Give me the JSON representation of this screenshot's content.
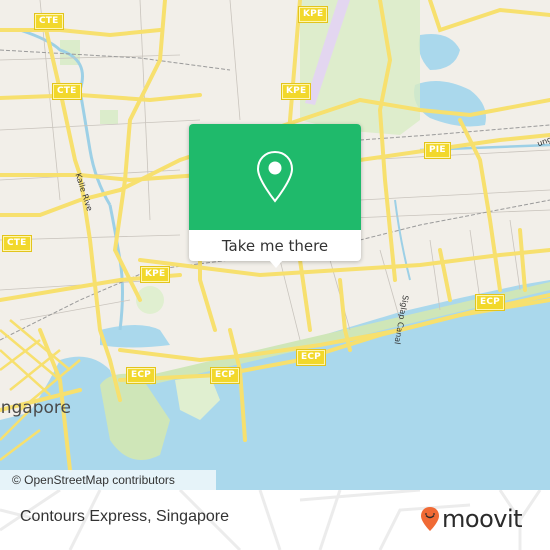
{
  "map": {
    "road_shields": [
      {
        "label": "CTE",
        "id": "cte-1"
      },
      {
        "label": "CTE",
        "id": "cte-2"
      },
      {
        "label": "CTE",
        "id": "cte-3"
      },
      {
        "label": "KPE",
        "id": "kpe-1"
      },
      {
        "label": "KPE",
        "id": "kpe-2"
      },
      {
        "label": "KPE",
        "id": "kpe-3"
      },
      {
        "label": "PIE",
        "id": "pie-1"
      },
      {
        "label": "ECP",
        "id": "ecp-1"
      },
      {
        "label": "ECP",
        "id": "ecp-2"
      },
      {
        "label": "ECP",
        "id": "ecp-3"
      },
      {
        "label": "ECP",
        "id": "ecp-4"
      }
    ],
    "labels": {
      "city": "Singapore",
      "city_visible": "ingapore",
      "river": "Kallang River",
      "river_visible": "Kalle Rive",
      "canal": "Siglap Canal",
      "canal_visible": "Siglap Canal",
      "road_partial": "ung"
    },
    "attribution": "© OpenStreetMap contributors"
  },
  "popup": {
    "icon": "map-pin-icon",
    "button_label": "Take me there",
    "color": "#1fba6b"
  },
  "footer": {
    "place_name": "Contours Express, Singapore",
    "brand": "moovit",
    "brand_color": "#f06a35"
  }
}
